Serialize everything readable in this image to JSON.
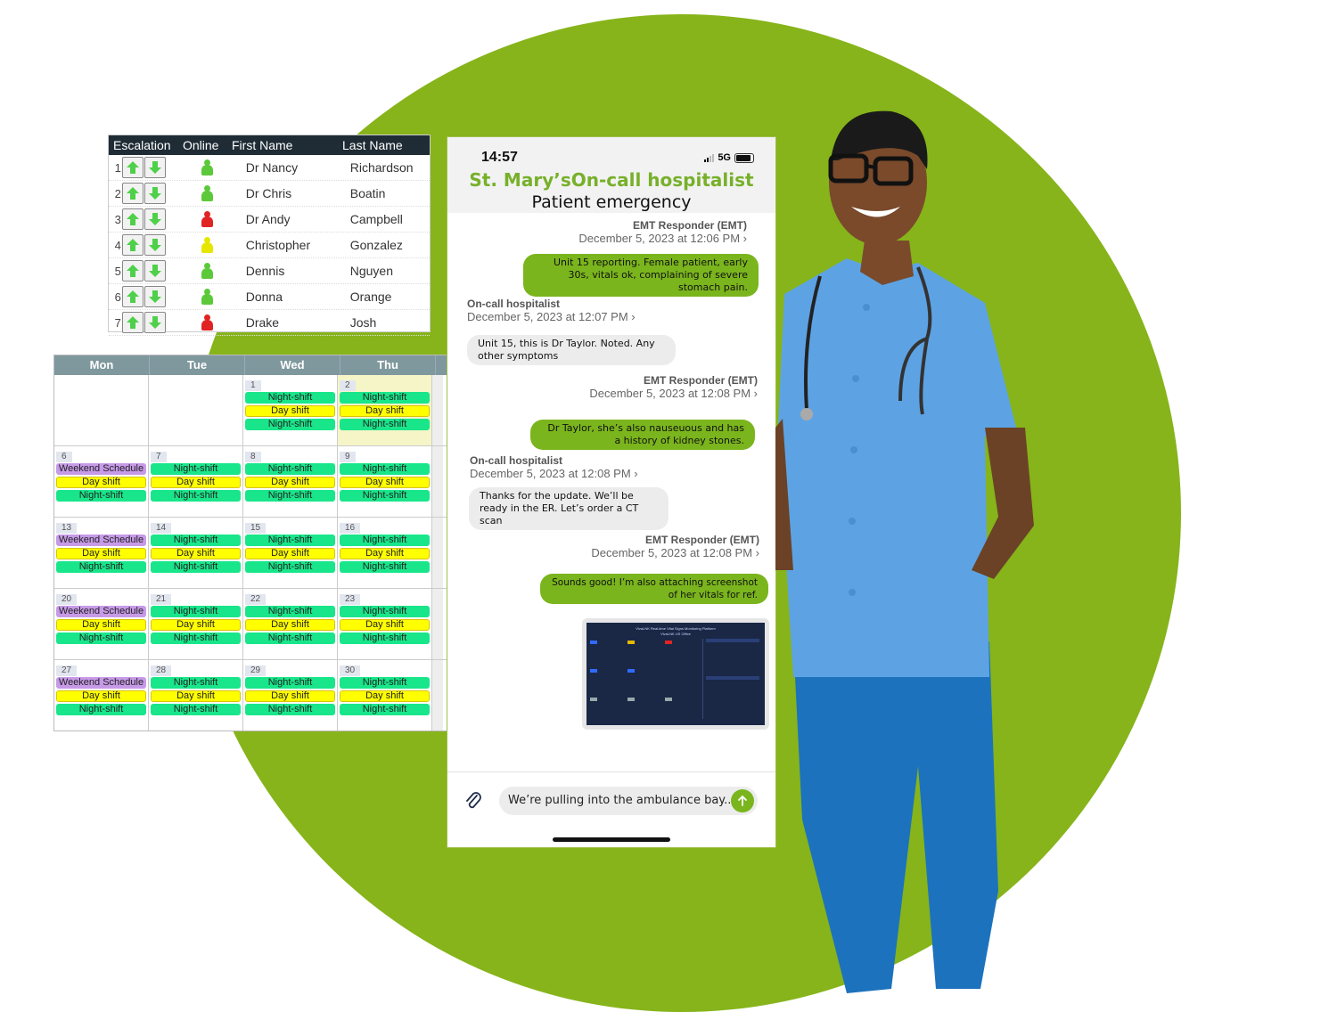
{
  "background": {
    "circle_color": "#86b41a"
  },
  "escalation_table": {
    "headers": [
      "Escalation",
      "Online",
      "First Name",
      "Last Name"
    ],
    "rows": [
      {
        "rank": "1",
        "status": "online",
        "first": "Dr Nancy",
        "last": "Richardson"
      },
      {
        "rank": "2",
        "status": "online",
        "first": "Dr Chris",
        "last": "Boatin"
      },
      {
        "rank": "3",
        "status": "offline",
        "first": "Dr Andy",
        "last": "Campbell"
      },
      {
        "rank": "4",
        "status": "away",
        "first": "Christopher",
        "last": "Gonzalez"
      },
      {
        "rank": "5",
        "status": "online",
        "first": "Dennis",
        "last": "Nguyen"
      },
      {
        "rank": "6",
        "status": "online",
        "first": "Donna",
        "last": "Orange"
      },
      {
        "rank": "7",
        "status": "offline",
        "first": "Drake",
        "last": "Josh"
      }
    ],
    "status_colors": {
      "online": "#5cc93a",
      "offline": "#e02424",
      "away": "#e6e600"
    },
    "arrow_color": "#4fd04a"
  },
  "calendar": {
    "days": [
      "Mon",
      "Tue",
      "Wed",
      "Thu"
    ],
    "weeks": [
      [
        {
          "num": "",
          "events": []
        },
        {
          "num": "",
          "events": []
        },
        {
          "num": "1",
          "events": [
            "Night-shift",
            "Day shift",
            "Night-shift"
          ]
        },
        {
          "num": "2",
          "today": true,
          "events": [
            "Night-shift",
            "Day shift",
            "Night-shift"
          ]
        }
      ],
      [
        {
          "num": "6",
          "events": [
            "Weekend Schedule",
            "Day shift",
            "Night-shift"
          ]
        },
        {
          "num": "7",
          "events": [
            "Night-shift",
            "Day shift",
            "Night-shift"
          ]
        },
        {
          "num": "8",
          "events": [
            "Night-shift",
            "Day shift",
            "Night-shift"
          ]
        },
        {
          "num": "9",
          "events": [
            "Night-shift",
            "Day shift",
            "Night-shift"
          ]
        }
      ],
      [
        {
          "num": "13",
          "events": [
            "Weekend Schedule",
            "Day shift",
            "Night-shift"
          ]
        },
        {
          "num": "14",
          "events": [
            "Night-shift",
            "Day shift",
            "Night-shift"
          ]
        },
        {
          "num": "15",
          "events": [
            "Night-shift",
            "Day shift",
            "Night-shift"
          ]
        },
        {
          "num": "16",
          "events": [
            "Night-shift",
            "Day shift",
            "Night-shift"
          ]
        }
      ],
      [
        {
          "num": "20",
          "events": [
            "Weekend Schedule",
            "Day shift",
            "Night-shift"
          ]
        },
        {
          "num": "21",
          "events": [
            "Night-shift",
            "Day shift",
            "Night-shift"
          ]
        },
        {
          "num": "22",
          "events": [
            "Night-shift",
            "Day shift",
            "Night-shift"
          ]
        },
        {
          "num": "23",
          "events": [
            "Night-shift",
            "Day shift",
            "Night-shift"
          ]
        }
      ],
      [
        {
          "num": "27",
          "events": [
            "Weekend Schedule",
            "Day shift",
            "Night-shift"
          ]
        },
        {
          "num": "28",
          "events": [
            "Night-shift",
            "Day shift",
            "Night-shift"
          ]
        },
        {
          "num": "29",
          "events": [
            "Night-shift",
            "Day shift",
            "Night-shift"
          ]
        },
        {
          "num": "30",
          "events": [
            "Night-shift",
            "Day shift",
            "Night-shift"
          ]
        }
      ]
    ]
  },
  "phone": {
    "time": "14:57",
    "network": "5G",
    "title": "St. Mary’sOn-call hospitalist",
    "subtitle": "Patient emergency",
    "messages": [
      {
        "sender": "EMT Responder (EMT)",
        "timestamp": "December 5, 2023 at 12:06 PM",
        "direction": "out",
        "text": "Unit 15 reporting. Female patient, early 30s, vitals ok, complaining of severe stomach pain."
      },
      {
        "sender": "On-call hospitalist",
        "timestamp": "December 5, 2023 at 12:07 PM",
        "direction": "in",
        "text": "Unit 15, this is Dr Taylor. Noted. Any other symptoms"
      },
      {
        "sender": "EMT Responder (EMT)",
        "timestamp": "December 5, 2023 at 12:08 PM",
        "direction": "out",
        "text": "Dr Taylor, she’s also nauseuous and has a history of kidney stones."
      },
      {
        "sender": "On-call hospitalist",
        "timestamp": "December 5, 2023 at 12:08 PM",
        "direction": "in",
        "text": "Thanks for the update. We’ll be ready in the ER. Let’s order a CT scan"
      },
      {
        "sender": "EMT Responder (EMT)",
        "timestamp": "December 5, 2023 at 12:08 PM",
        "direction": "out",
        "text": "Sounds good! I’m also attaching  screenshot of her vitals for ref."
      }
    ],
    "attachment": {
      "title": "VivaLNK Real-time Vital Signs Monitoring Platform",
      "subtitle": "VivaLNK US Office"
    },
    "composer": {
      "value": "We’re pulling into the ambulance bay.."
    },
    "accent": "#7ab51d"
  }
}
